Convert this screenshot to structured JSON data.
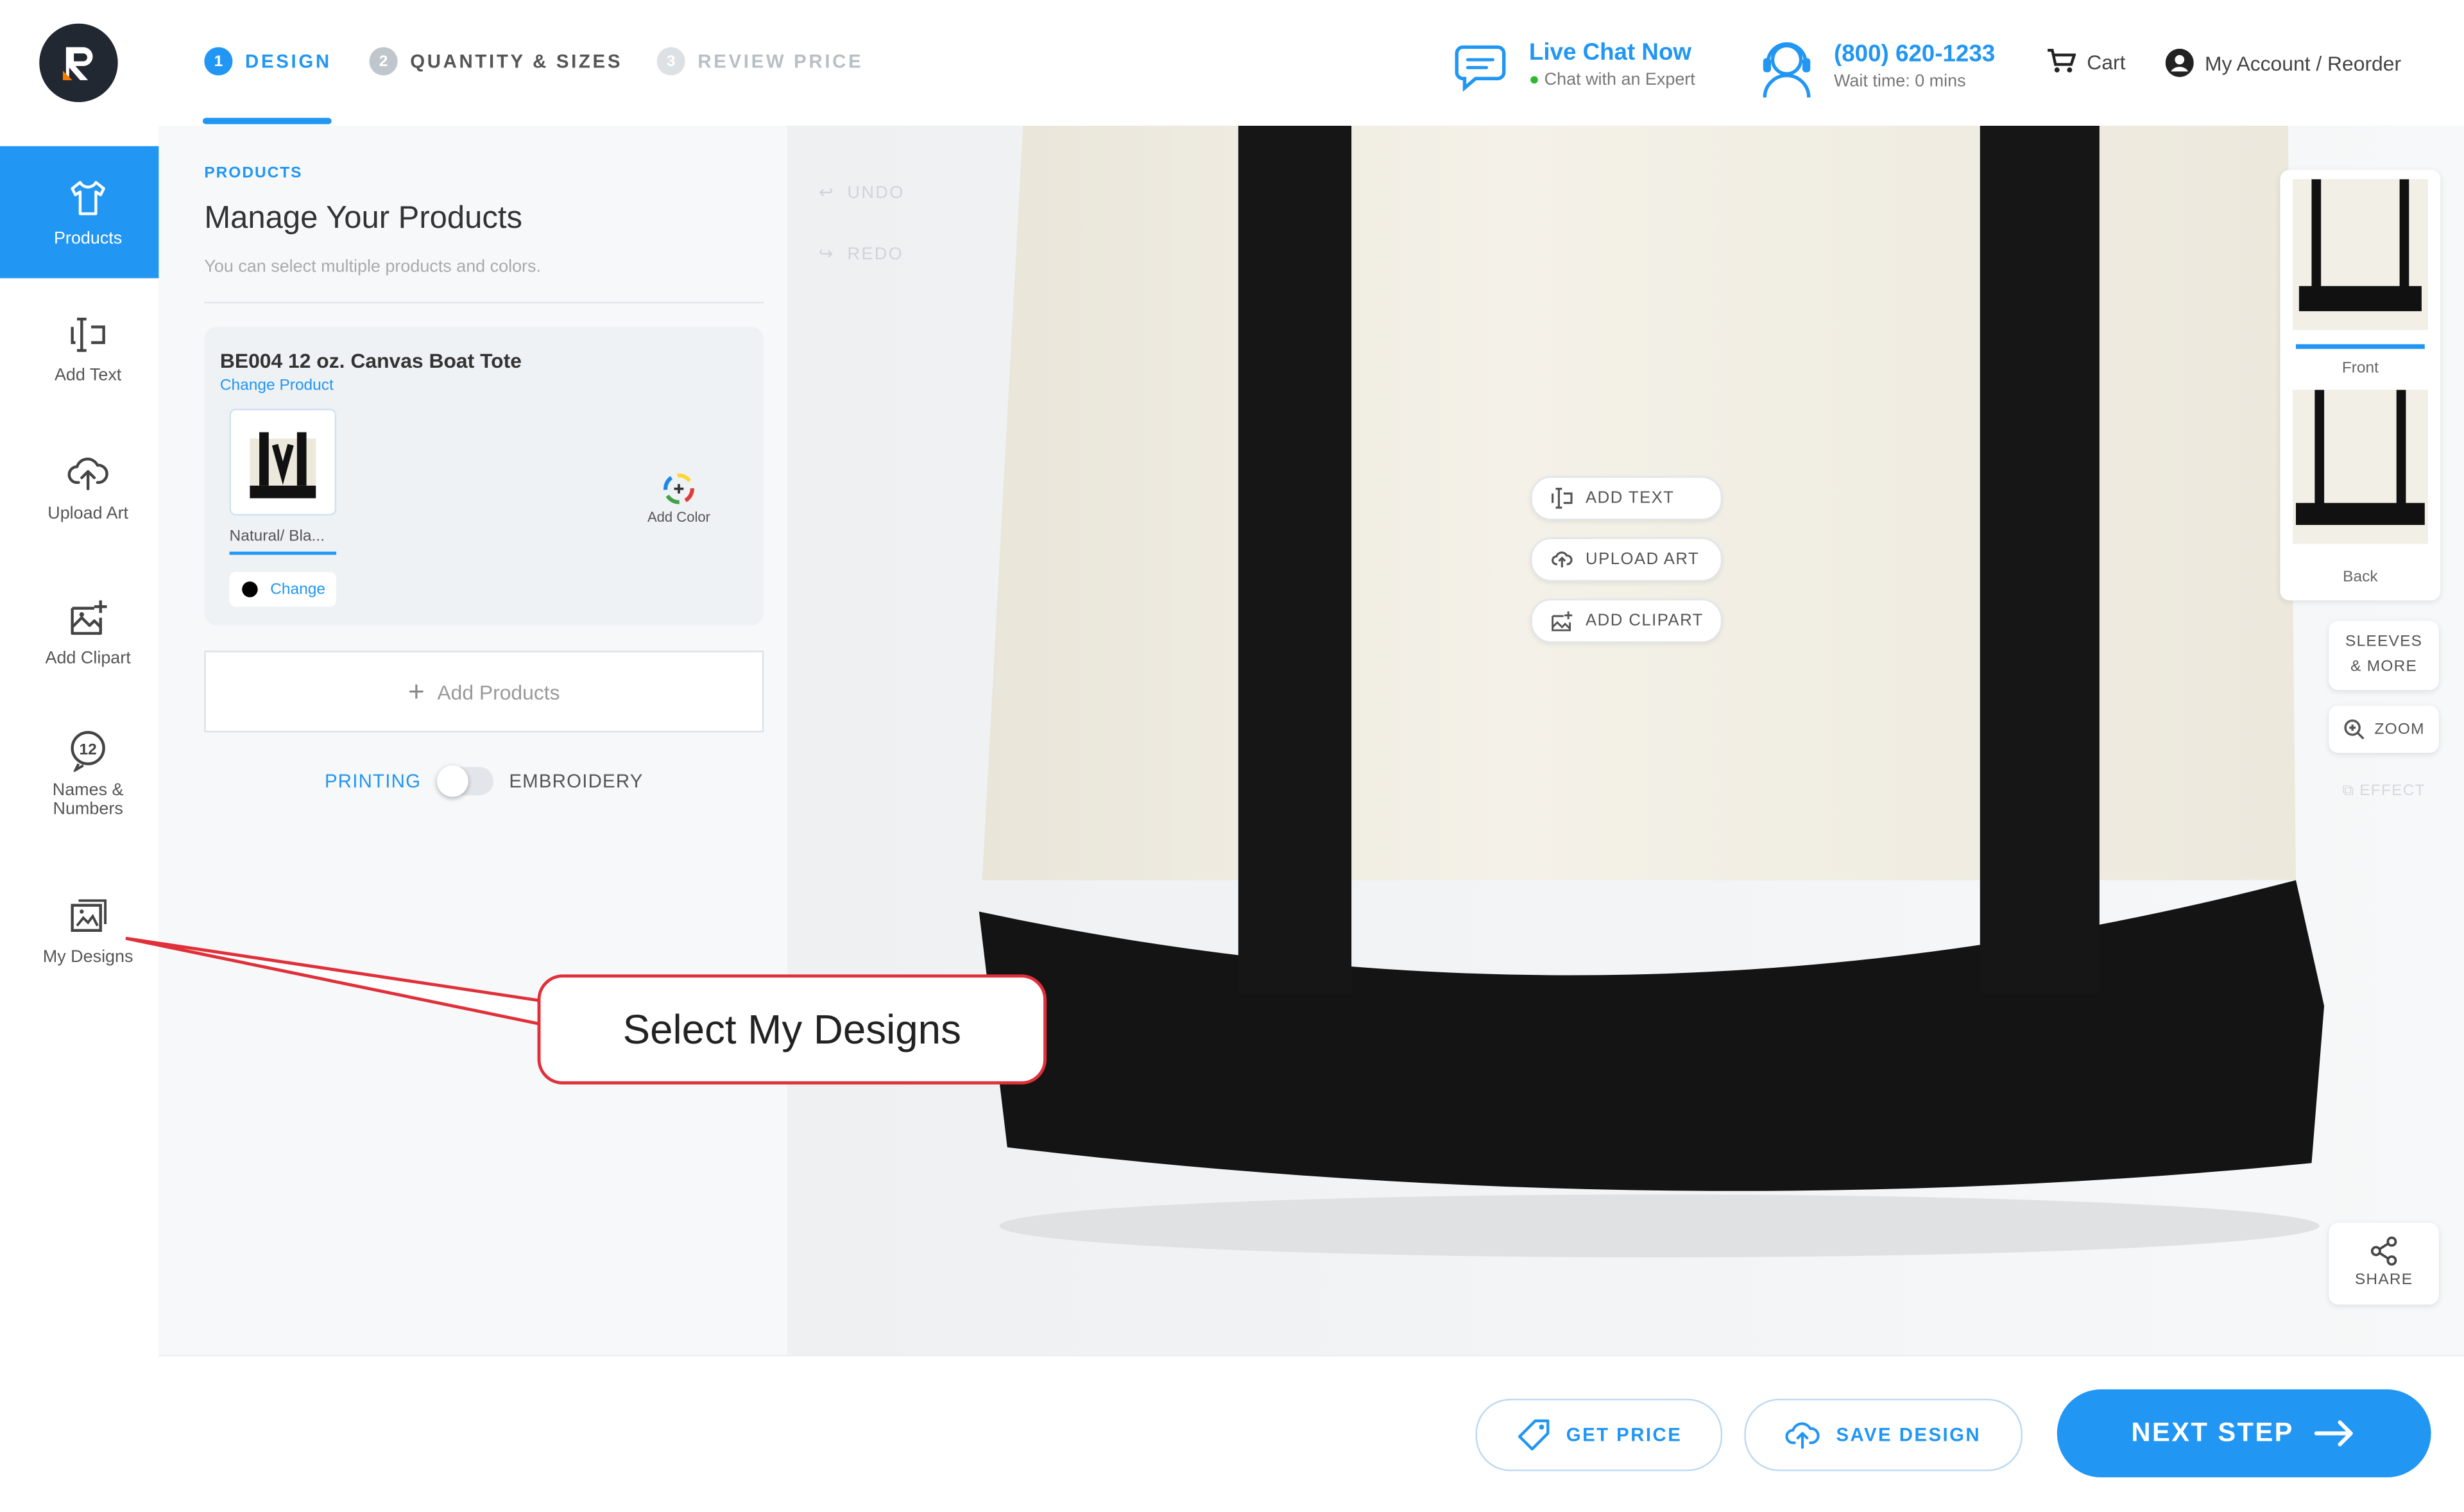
{
  "steps": [
    {
      "num": "1",
      "label": "DESIGN"
    },
    {
      "num": "2",
      "label": "QUANTITY & SIZES"
    },
    {
      "num": "3",
      "label": "REVIEW PRICE"
    }
  ],
  "header": {
    "live_chat_title": "Live Chat Now",
    "live_chat_sub": "Chat with an Expert",
    "phone": "(800) 620-1233",
    "wait_time": "Wait time: 0 mins",
    "cart": "Cart",
    "account": "My Account / Reorder"
  },
  "sidebar": {
    "items": [
      {
        "label": "Products"
      },
      {
        "label": "Add Text"
      },
      {
        "label": "Upload Art"
      },
      {
        "label": "Add Clipart"
      },
      {
        "label": "Names & Numbers"
      },
      {
        "label": "My Designs"
      }
    ]
  },
  "panel": {
    "crumb": "PRODUCTS",
    "title": "Manage Your Products",
    "subtitle": "You can select multiple products and colors.",
    "product_name": "BE004 12 oz. Canvas Boat Tote",
    "change_product": "Change Product",
    "color_name": "Natural/ Bla...",
    "change_label": "Change",
    "add_color": "Add Color",
    "add_products": "Add Products",
    "printing": "PRINTING",
    "embroidery": "EMBROIDERY"
  },
  "canvas": {
    "undo": "UNDO",
    "redo": "REDO",
    "add_text": "ADD TEXT",
    "upload_art": "UPLOAD ART",
    "add_clipart": "ADD CLIPART"
  },
  "views": {
    "front": "Front",
    "back": "Back",
    "sleeves_line1": "SLEEVES",
    "sleeves_line2": "& MORE",
    "zoom": "ZOOM",
    "effect": "EFFECT",
    "share": "SHARE"
  },
  "footer": {
    "get_price": "GET PRICE",
    "save_design": "SAVE DESIGN",
    "next_step": "NEXT STEP"
  },
  "callout": {
    "text": "Select My Designs"
  },
  "colors": {
    "accent": "#2196f3",
    "callout_border": "#e0303a",
    "bag_canvas": "#f2efe6",
    "bag_trim": "#141414"
  }
}
